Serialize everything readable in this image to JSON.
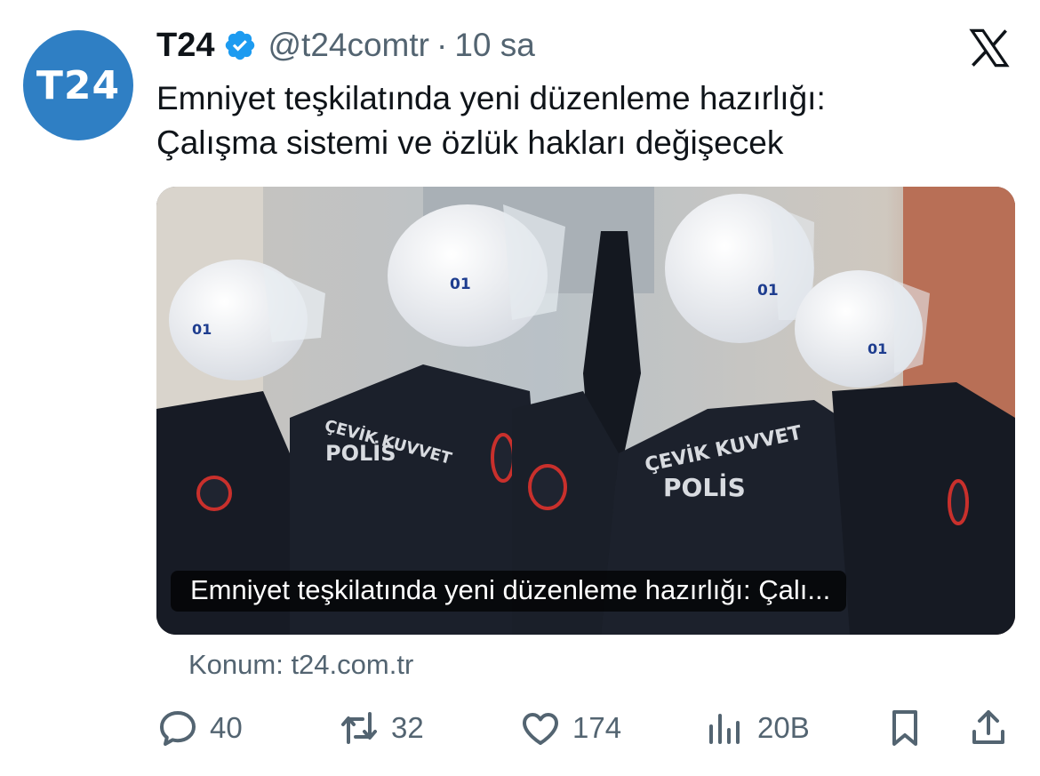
{
  "tweet": {
    "avatar_text": "T24",
    "display_name": "T24",
    "handle": "@t24comtr",
    "separator": "·",
    "time": "10 sa",
    "text_lines": [
      "Emniyet teşkilatında yeni düzenleme hazırlığı:",
      "Çalışma sistemi ve özlük hakları değişecek"
    ]
  },
  "card": {
    "title": "Emniyet teşkilatında yeni düzenleme hazırlığı: Çalı...",
    "image_labels": {
      "unit": "ÇEVİK KUVVET",
      "polis": "POLİS",
      "helmet": "01"
    }
  },
  "source": {
    "text": "Konum: t24.com.tr"
  },
  "actions": {
    "replies": "40",
    "retweets": "32",
    "likes": "174",
    "views": "20B"
  },
  "colors": {
    "avatar": "#2f7fc4",
    "verified": "#1d9bf0",
    "muted": "#536471"
  }
}
